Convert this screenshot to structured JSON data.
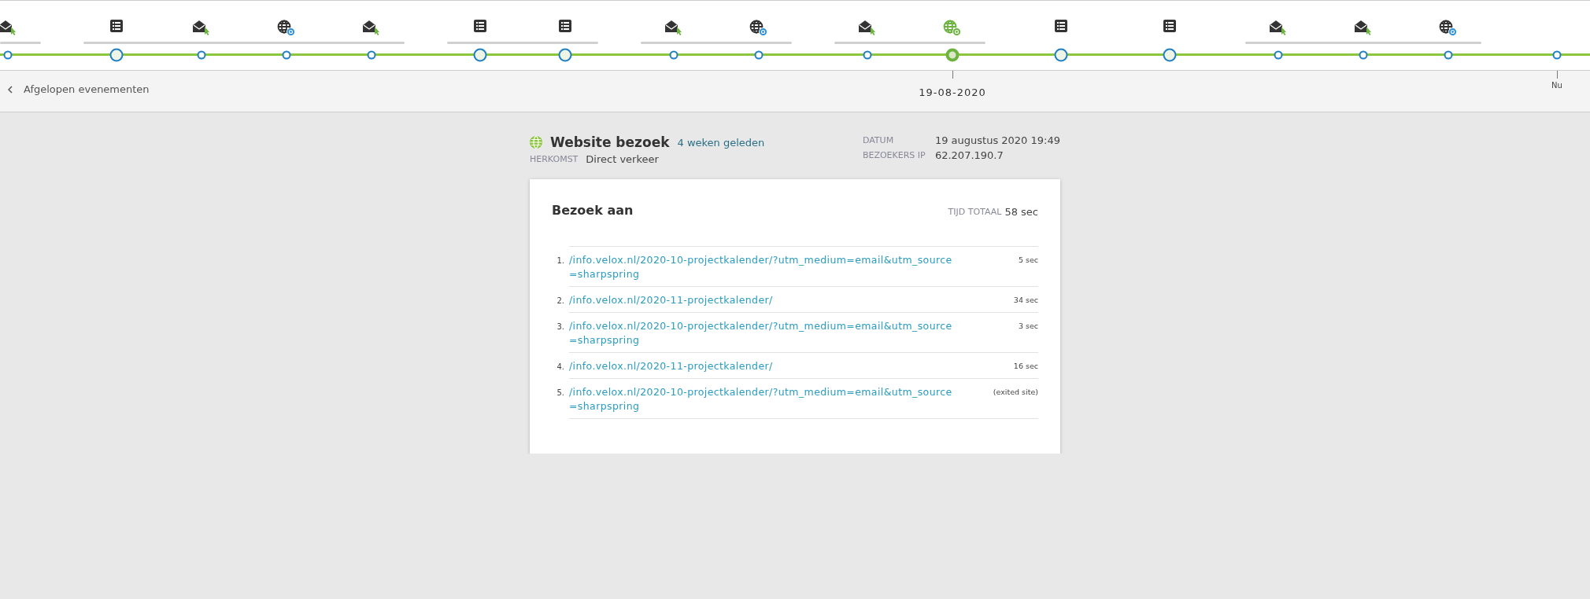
{
  "timeline": {
    "groups": [
      {
        "bracketed": true,
        "events": [
          {
            "kind": "mail",
            "selected": false
          }
        ]
      },
      {
        "bracketed": true,
        "events": [
          {
            "kind": "list",
            "selected": false
          },
          {
            "kind": "mail",
            "selected": false
          },
          {
            "kind": "web",
            "selected": false
          },
          {
            "kind": "mail",
            "selected": false
          }
        ]
      },
      {
        "bracketed": true,
        "events": [
          {
            "kind": "list",
            "selected": false
          },
          {
            "kind": "list",
            "selected": false
          }
        ]
      },
      {
        "bracketed": true,
        "events": [
          {
            "kind": "mail",
            "selected": false
          },
          {
            "kind": "web",
            "selected": false
          }
        ]
      },
      {
        "bracketed": true,
        "events": [
          {
            "kind": "mail",
            "selected": false
          },
          {
            "kind": "web",
            "selected": true
          }
        ]
      },
      {
        "bracketed": false,
        "events": [
          {
            "kind": "list",
            "selected": false
          }
        ]
      },
      {
        "bracketed": false,
        "events": [
          {
            "kind": "list",
            "selected": false
          }
        ]
      },
      {
        "bracketed": true,
        "events": [
          {
            "kind": "mail",
            "selected": false
          },
          {
            "kind": "mail",
            "selected": false
          },
          {
            "kind": "web",
            "selected": false
          }
        ]
      }
    ],
    "selected_date": "19-08-2020",
    "now_label": "Nu"
  },
  "nav": {
    "back_label": "Afgelopen evenementen"
  },
  "visit": {
    "title": "Website bezoek",
    "ago": "4 weken geleden",
    "origin_label": "HERKOMST",
    "origin": "Direct verkeer",
    "details": [
      {
        "label": "DATUM",
        "value": "19 augustus 2020 19:49"
      },
      {
        "label": "BEZOEKERS IP",
        "value": "62.207.190.7"
      }
    ]
  },
  "card": {
    "title": "Bezoek aan",
    "total_label": "TIJD TOTAAL",
    "total": "58 sec",
    "pages": [
      {
        "number": "1.",
        "url": "/info.velox.nl/2020-10-projectkalender/?utm_medium=email&utm_source=sharpspring",
        "time": "5 sec"
      },
      {
        "number": "2.",
        "url": "/info.velox.nl/2020-11-projectkalender/",
        "time": "34 sec"
      },
      {
        "number": "3.",
        "url": "/info.velox.nl/2020-10-projectkalender/?utm_medium=email&utm_source=sharpspring",
        "time": "3 sec"
      },
      {
        "number": "4.",
        "url": "/info.velox.nl/2020-11-projectkalender/",
        "time": "16 sec"
      },
      {
        "number": "5.",
        "url": "/info.velox.nl/2020-10-projectkalender/?utm_medium=email&utm_source=sharpspring",
        "time": "(exited site)"
      }
    ]
  }
}
